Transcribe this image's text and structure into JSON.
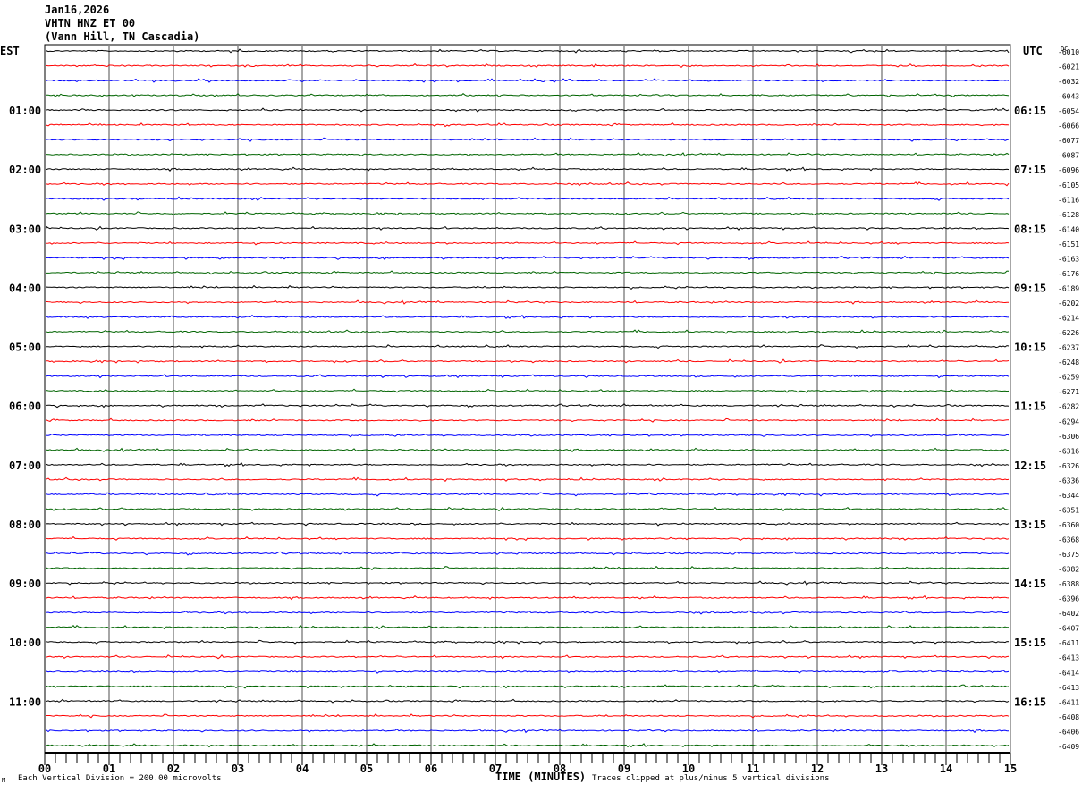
{
  "header": {
    "date": "Jan16,2026",
    "station": "VHTN HNZ ET 00",
    "location": "(Vann Hill, TN Cascadia)"
  },
  "chart_data": {
    "type": "line",
    "title": "Jan16,2026 VHTN HNZ ET 00 (Vann Hill, TN Cascadia)",
    "xlabel": "TIME (MINUTES)",
    "xlim": [
      0,
      15
    ],
    "x_ticks": [
      "00",
      "01",
      "02",
      "03",
      "04",
      "05",
      "06",
      "07",
      "08",
      "09",
      "10",
      "11",
      "12",
      "13",
      "14",
      "15"
    ],
    "left_timezone": "EST",
    "right_timezone": "UTC",
    "left_hour_labels": [
      "01:00",
      "02:00",
      "03:00",
      "04:00",
      "05:00",
      "06:00",
      "07:00",
      "08:00",
      "09:00",
      "10:00",
      "11:00"
    ],
    "right_hour_labels": [
      "06:15",
      "07:15",
      "08:15",
      "09:15",
      "10:15",
      "11:15",
      "12:15",
      "13:15",
      "14:15",
      "15:15",
      "16:15"
    ],
    "dc_label": "DC",
    "dc_offsets": [
      "-6010",
      "-6021",
      "-6032",
      "-6043",
      "-6054",
      "-6066",
      "-6077",
      "-6087",
      "-6096",
      "-6105",
      "-6116",
      "-6128",
      "-6140",
      "-6151",
      "-6163",
      "-6176",
      "-6189",
      "-6202",
      "-6214",
      "-6226",
      "-6237",
      "-6248",
      "-6259",
      "-6271",
      "-6282",
      "-6294",
      "-6306",
      "-6316",
      "-6326",
      "-6336",
      "-6344",
      "-6351",
      "-6360",
      "-6368",
      "-6375",
      "-6382",
      "-6388",
      "-6396",
      "-6402",
      "-6407",
      "-6411",
      "-6413",
      "-6414",
      "-6413",
      "-6411",
      "-6408",
      "-6406",
      "-6409"
    ],
    "trace_colors": [
      "#000000",
      "#ff0000",
      "#0000ff",
      "#006400"
    ],
    "grid": true,
    "scale_note": "Each Vertical Division =  200.00 microvolts",
    "clip_note": "Traces clipped at plus/minus 5 vertical divisions"
  }
}
